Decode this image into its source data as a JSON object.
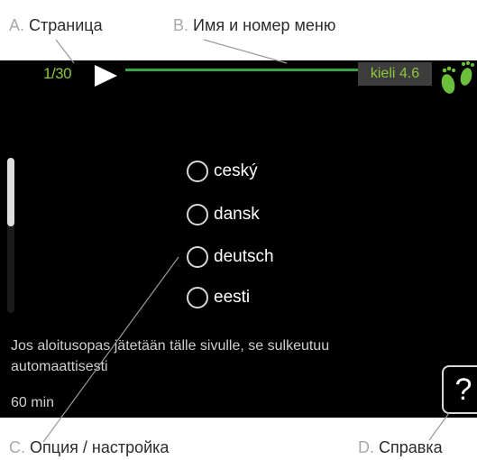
{
  "callouts": {
    "a": {
      "letter": "A.",
      "text": "Страница"
    },
    "b": {
      "letter": "B.",
      "text": "Имя и номер меню"
    },
    "c": {
      "letter": "C.",
      "text": "Опция / настройка"
    },
    "d": {
      "letter": "D.",
      "text": "Справка"
    }
  },
  "screen": {
    "page_indicator": "1/30",
    "menu_title": "kieli 4.6",
    "options": [
      {
        "label": "ceský",
        "selected": false
      },
      {
        "label": "dansk",
        "selected": false
      },
      {
        "label": "deutsch",
        "selected": false
      },
      {
        "label": "eesti",
        "selected": false
      }
    ],
    "info_text": "Jos aloitusopas jätetään tälle sivulle, se sulkeutuu automaattisesti",
    "timeout_text": "60 min",
    "help_label": "?",
    "scroll_position": 0.0
  },
  "colors": {
    "screen_bg": "#000000",
    "accent_green": "#8dc63f",
    "menu_line_green": "#3aa34a",
    "title_box_bg": "#3d3d3d"
  },
  "icons": [
    "play-arrow-icon",
    "footprints-icon",
    "help-icon"
  ]
}
